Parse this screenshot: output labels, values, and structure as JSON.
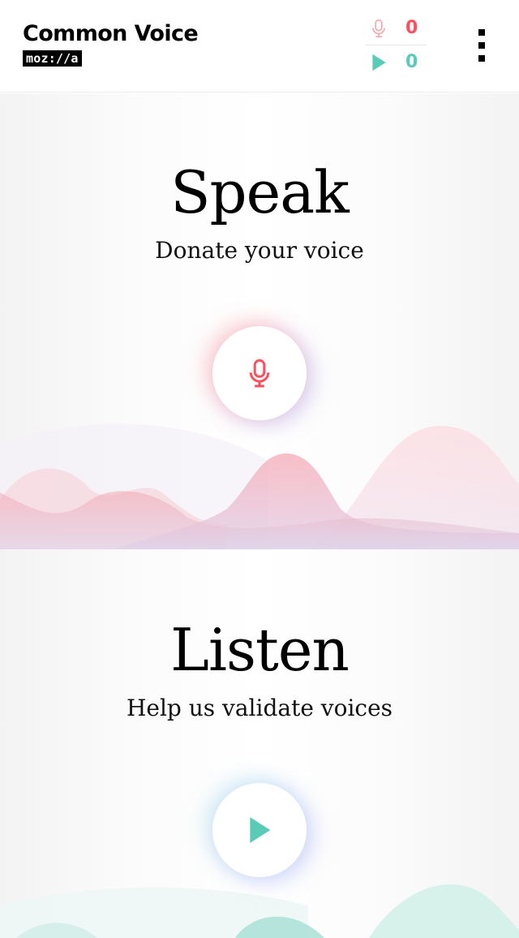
{
  "header": {
    "brand_title": "Common Voice",
    "brand_sub": "moz://a",
    "stats": {
      "recorded": "0",
      "validated": "0"
    },
    "icons": {
      "recorded": "microphone-icon",
      "validated": "play-icon",
      "menu": "kebab-menu-icon"
    }
  },
  "speak": {
    "title": "Speak",
    "subtitle": "Donate your voice",
    "button_icon": "microphone-icon"
  },
  "listen": {
    "title": "Listen",
    "subtitle": "Help us validate voices",
    "button_icon": "play-icon"
  },
  "colors": {
    "accent_red": "#ff4f5e",
    "accent_teal": "#59cbb7",
    "text": "#000000"
  }
}
